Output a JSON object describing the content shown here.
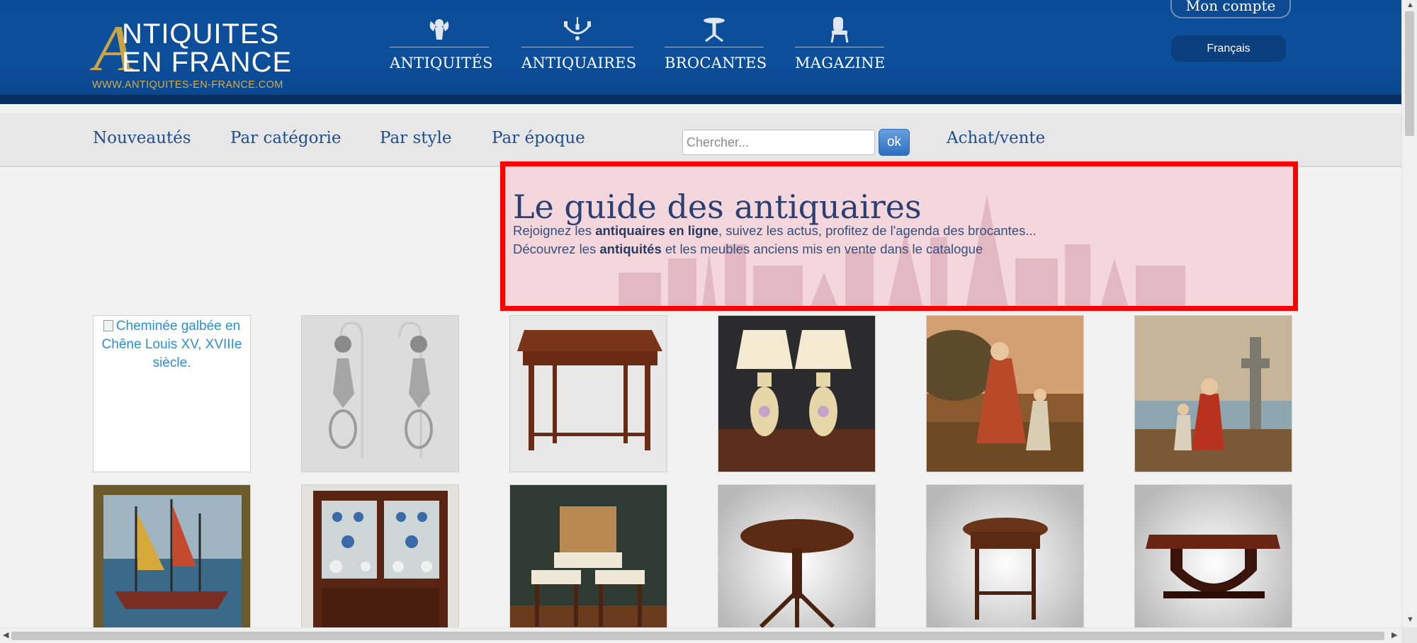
{
  "header": {
    "logo": {
      "big_letter": "A",
      "line1": "NTIQUITES",
      "line2": "EN FRANCE",
      "url": "WWW.ANTIQUITES-EN-FRANCE.COM"
    },
    "main_nav": [
      {
        "label": "ANTIQUITÉS",
        "icon": "cherub-icon"
      },
      {
        "label": "ANTIQUAIRES",
        "icon": "chandelier-icon"
      },
      {
        "label": "BROCANTES",
        "icon": "pedestal-table-icon"
      },
      {
        "label": "MAGAZINE",
        "icon": "chair-icon"
      }
    ],
    "account_label": "Mon compte",
    "language": "Français"
  },
  "sub_nav": {
    "links": [
      "Nouveautés",
      "Par catégorie",
      "Par style",
      "Par époque"
    ],
    "search_placeholder": "Chercher...",
    "search_button": "ok",
    "buy_sell": "Achat/vente"
  },
  "hero": {
    "title": "Le guide des antiquaires",
    "line1": {
      "before": "Rejoignez les ",
      "bold": "antiquaires en ligne",
      "after": ", suivez les actus, profitez de l'agenda des brocantes..."
    },
    "line2": {
      "before": "Découvrez les ",
      "bold": "antiquités",
      "after": " et les meubles anciens mis en vente dans le catalogue"
    }
  },
  "products": [
    {
      "alt": "Cheminée galbée en Chêne Louis XV, XVIIIe siècle.",
      "image_loaded": false
    },
    {
      "subject": "earrings"
    },
    {
      "subject": "side-table"
    },
    {
      "subject": "lamps"
    },
    {
      "subject": "painting-mother-child"
    },
    {
      "subject": "painting-seaside-cross"
    },
    {
      "subject": "painting-harbor"
    },
    {
      "subject": "bookcase-cabinet"
    },
    {
      "subject": "chairs"
    },
    {
      "subject": "round-table"
    },
    {
      "subject": "small-table"
    },
    {
      "subject": "art-deco-table"
    }
  ],
  "colors": {
    "header_blue": "#0b4c97",
    "gold": "#c9a445",
    "link_blue": "#1f4e8c",
    "highlight_red": "#ff0000"
  }
}
